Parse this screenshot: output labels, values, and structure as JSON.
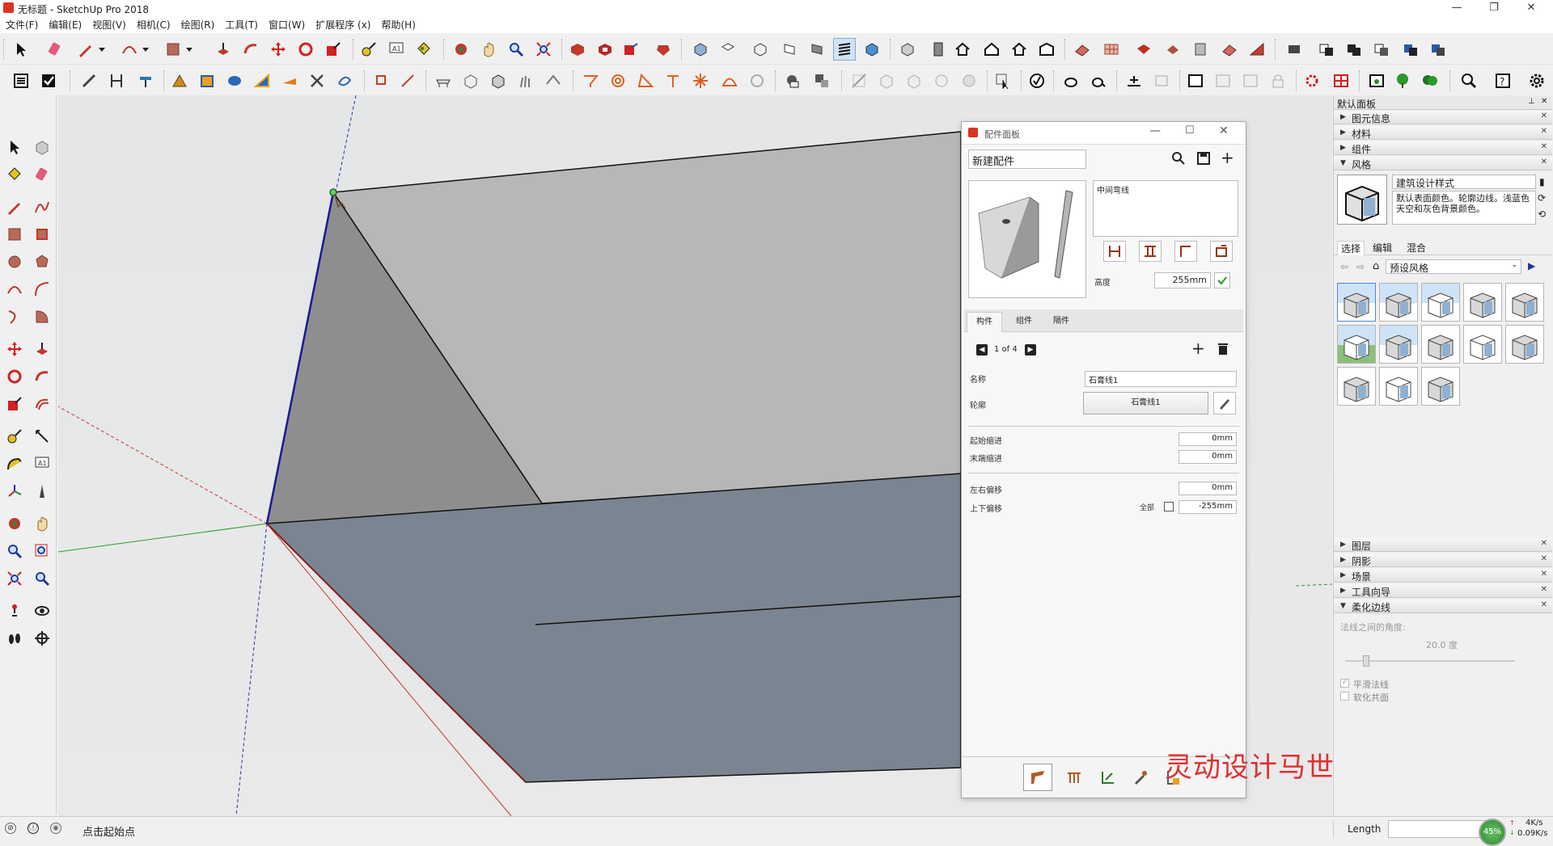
{
  "window": {
    "title": "无标题 - SketchUp Pro 2018",
    "controls": [
      "—",
      "❐",
      "✕"
    ]
  },
  "menu": [
    "文件(F)",
    "编辑(E)",
    "视图(V)",
    "相机(C)",
    "绘图(R)",
    "工具(T)",
    "窗口(W)",
    "扩展程序 (x)",
    "帮助(H)"
  ],
  "component_panel": {
    "title": "配件面板",
    "name_field": "新建配件",
    "preview_label": "中间弯线",
    "height_label": "高度",
    "height_value": "255mm",
    "tabs": [
      "构件",
      "组件",
      "隔件"
    ],
    "pager": "1 of 4",
    "rows": {
      "name_label": "名称",
      "name_value": "石膏线1",
      "profile_label": "轮廓",
      "profile_value": "石膏线1",
      "start_label": "起始缩进",
      "start_value": "0mm",
      "end_label": "末端缩进",
      "end_value": "0mm",
      "lr_label": "左右偏移",
      "lr_value": "0mm",
      "ud_label": "上下偏移",
      "all_label": "全部",
      "ud_value": "-255mm"
    }
  },
  "tray": {
    "title": "默认面板",
    "sections_top": [
      "图元信息",
      "材料",
      "组件",
      "风格"
    ],
    "style_name": "建筑设计样式",
    "style_desc": "默认表面颜色。轮廓边线。浅蓝色天空和灰色背景颜色。",
    "style_tabs": [
      "选择",
      "编辑",
      "混合"
    ],
    "style_dropdown": "预设风格",
    "sections_bottom": [
      "图层",
      "阴影",
      "场景",
      "工具向导",
      "柔化边线"
    ],
    "soften": {
      "angle_label": "法线之间的角度:",
      "angle_value": "20.0  度",
      "smooth_normals": "平滑法线",
      "soften_coplanar": "软化共面"
    }
  },
  "watermark": "灵动设计马世强",
  "status": {
    "hint": "点击起始点",
    "measure_label": "Length",
    "measure_value": "",
    "cpu_percent": "45%",
    "up_speed": "4K/s",
    "down_speed": "0.09K/s"
  },
  "colors": {
    "face_light": "#b4b4b4",
    "face_dark": "#8c8c8c",
    "face_bottom": "#7c8590",
    "axis_red": "#c0392b",
    "axis_green": "#2e9b2e",
    "axis_blue": "#2a2aa8",
    "watermark": "#e03030"
  }
}
